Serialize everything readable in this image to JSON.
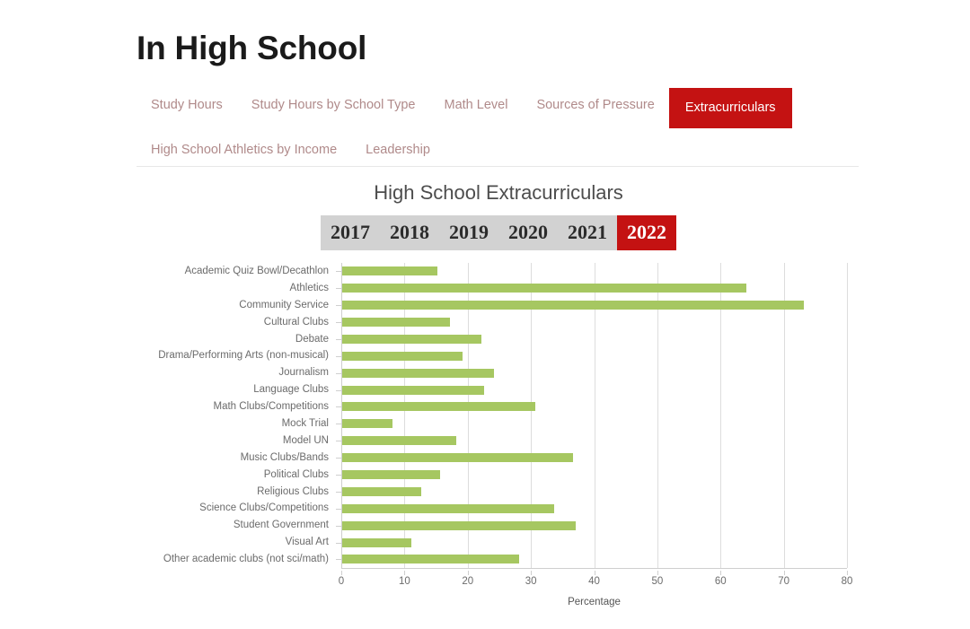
{
  "page": {
    "title": "In High School"
  },
  "tabs": {
    "row1": [
      {
        "label": "Study Hours",
        "selected": false
      },
      {
        "label": "Study Hours by School Type",
        "selected": false
      },
      {
        "label": "Math Level",
        "selected": false
      },
      {
        "label": "Sources of Pressure",
        "selected": false
      },
      {
        "label": "Extracurriculars",
        "selected": true
      }
    ],
    "row2": [
      {
        "label": "High School Athletics by Income",
        "selected": false
      },
      {
        "label": "Leadership",
        "selected": false
      }
    ]
  },
  "year_selector": {
    "years": [
      "2017",
      "2018",
      "2019",
      "2020",
      "2021",
      "2022"
    ],
    "selected": "2022"
  },
  "colors": {
    "accent_red": "#c41212",
    "bar_green": "#a6c761",
    "selector_bg": "#d2d2d2",
    "grid": "#dddddd",
    "label_text": "#6b6b6b"
  },
  "chart_data": {
    "type": "bar",
    "orientation": "horizontal",
    "title": "High School Extracurriculars",
    "xlabel": "Percentage",
    "ylabel": "",
    "xlim": [
      0,
      80
    ],
    "xticks": [
      0,
      10,
      20,
      30,
      40,
      50,
      60,
      70,
      80
    ],
    "grid": true,
    "legend": "none",
    "series_name": "2022",
    "categories": [
      "Academic Quiz Bowl/Decathlon",
      "Athletics",
      "Community Service",
      "Cultural Clubs",
      "Debate",
      "Drama/Performing Arts (non-musical)",
      "Journalism",
      "Language Clubs",
      "Math Clubs/Competitions",
      "Mock Trial",
      "Model UN",
      "Music Clubs/Bands",
      "Political Clubs",
      "Religious Clubs",
      "Science Clubs/Competitions",
      "Student Government",
      "Visual Art",
      "Other academic clubs (not sci/math)"
    ],
    "values": [
      15,
      64,
      73,
      17,
      22,
      19,
      24,
      22.5,
      30.5,
      8,
      18,
      36.5,
      15.5,
      12.5,
      33.5,
      37,
      11,
      28
    ]
  }
}
